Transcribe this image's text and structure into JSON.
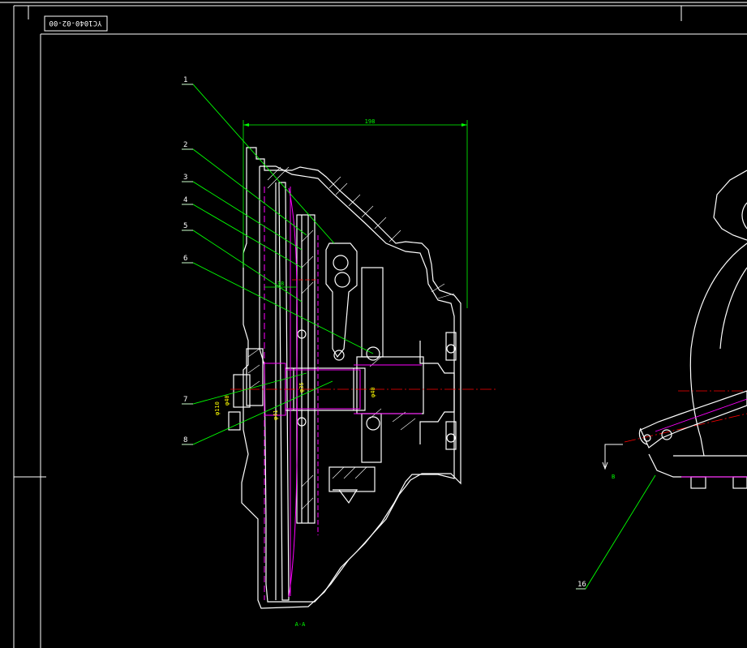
{
  "drawing_number": "YC1040-02-00",
  "colors": {
    "background": "#000000",
    "outline": "#ffffff",
    "leader": "#00ff00",
    "centerline": "#ff0000",
    "hidden": "#ff00ff",
    "dimension_text": "#ffff00"
  },
  "part_labels": [
    "1",
    "2",
    "3",
    "4",
    "5",
    "6",
    "7",
    "8"
  ],
  "detail_label": "16",
  "dimensions": {
    "overall_width": "198",
    "inner_gap": "38",
    "dia_1": "φ35",
    "dia_2": "φ40",
    "dia_3": "φ41",
    "dia_4": "φ110",
    "dia_5": "φ40"
  },
  "section_label": "A-A",
  "view_arrow_label": "B"
}
